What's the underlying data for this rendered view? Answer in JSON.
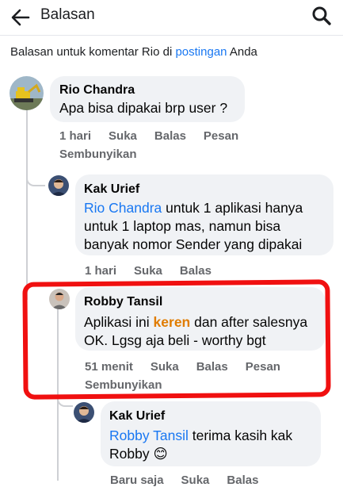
{
  "header": {
    "title": "Balasan"
  },
  "subheader": {
    "prefix": "Balasan untuk komentar Rio di ",
    "link": "postingan",
    "suffix": " Anda"
  },
  "comments": [
    {
      "author": "Rio Chandra",
      "text": "Apa bisa dipakai brp user ?",
      "time": "1 hari",
      "like": "Suka",
      "reply": "Balas",
      "message": "Pesan",
      "hide": "Sembunyikan"
    },
    {
      "author": "Kak Urief",
      "mention": "Rio Chandra",
      "text_line1": " untuk 1 aplikasi hanya",
      "text_line2": "untuk 1 laptop mas, namun bisa",
      "text_line3": "banyak nomor Sender yang dipakai",
      "time": "1 hari",
      "like": "Suka",
      "reply": "Balas"
    },
    {
      "author": "Robby Tansil",
      "text_a": "Aplikasi ini ",
      "keyword": "keren",
      "text_b": " dan after salesnya",
      "text_line2": "OK. Lgsg aja beli - worthy bgt",
      "time": "51 menit",
      "like": "Suka",
      "reply": "Balas",
      "message": "Pesan",
      "hide": "Sembunyikan"
    },
    {
      "author": "Kak Urief",
      "mention": "Robby Tansil",
      "text_line1": " terima kasih kak",
      "text_line2": "Robby ",
      "emoji": "😊",
      "time": "Baru saja",
      "like": "Suka",
      "reply": "Balas"
    }
  ],
  "colors": {
    "accent": "#1877f2",
    "highlight_box": "#f01010",
    "keyword": "#e07c00"
  }
}
